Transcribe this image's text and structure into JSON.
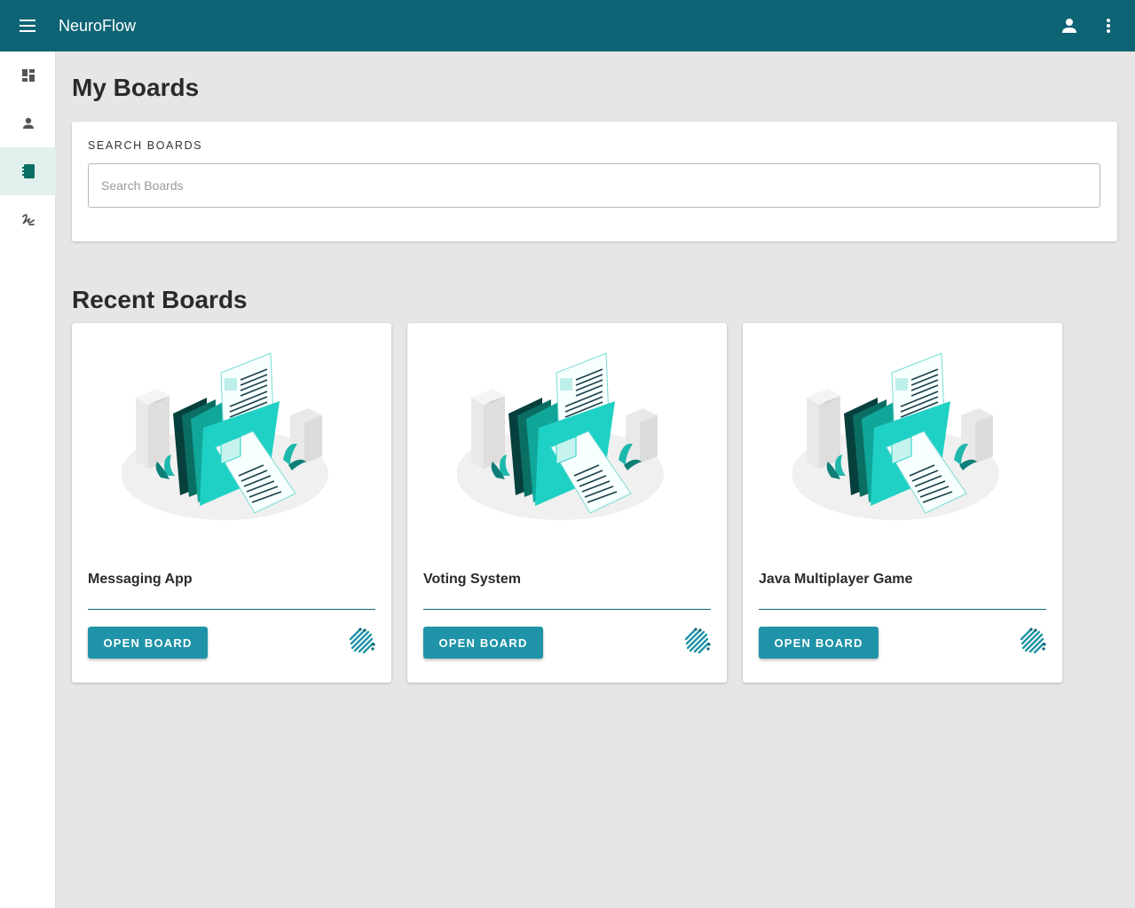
{
  "app": {
    "title": "NeuroFlow"
  },
  "topbar": {
    "menu_icon": "menu-icon",
    "account_icon": "account-icon",
    "more_icon": "more-vert-icon"
  },
  "sidebar": {
    "items": [
      {
        "icon": "dashboard-icon",
        "active": false
      },
      {
        "icon": "person-icon",
        "active": false
      },
      {
        "icon": "notebook-icon",
        "active": true
      },
      {
        "icon": "scribble-icon",
        "active": false
      }
    ]
  },
  "page": {
    "title": "My Boards",
    "search": {
      "label": "SEARCH BOARDS",
      "placeholder": "Search Boards",
      "value": ""
    },
    "recent_title": "Recent Boards"
  },
  "boards": [
    {
      "name": "Messaging App",
      "button": "OPEN BOARD"
    },
    {
      "name": "Voting System",
      "button": "OPEN BOARD"
    },
    {
      "name": "Java Multiplayer Game",
      "button": "OPEN BOARD"
    }
  ],
  "colors": {
    "primary": "#0e6475",
    "accent": "#1f93a7",
    "teal": "#1fd1c4",
    "background": "#e6e6e6"
  }
}
